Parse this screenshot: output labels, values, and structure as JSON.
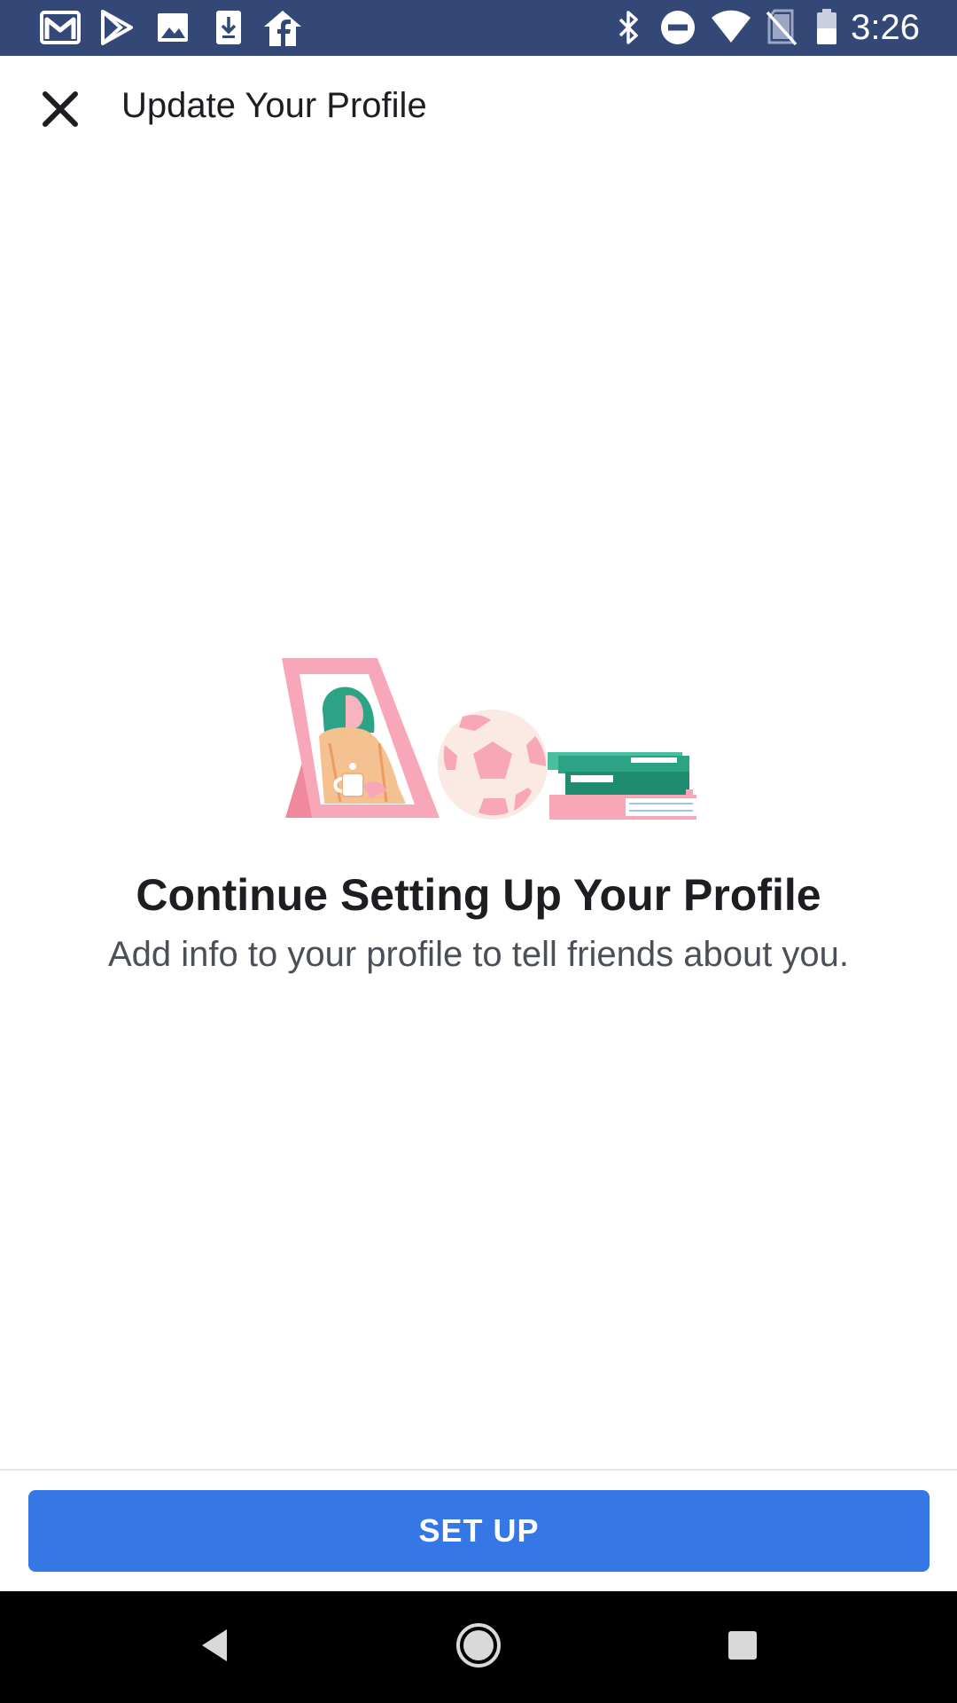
{
  "status_bar": {
    "time": "3:26",
    "background": "#344878",
    "left_icons": [
      "gmail-icon",
      "play-store-icon",
      "photos-icon",
      "download-icon",
      "facebook-home-icon"
    ],
    "right_icons": [
      "bluetooth-icon",
      "do-not-disturb-icon",
      "wifi-icon",
      "no-sim-icon",
      "battery-icon"
    ]
  },
  "app_bar": {
    "title": "Update Your Profile",
    "close_icon": "close-icon"
  },
  "content": {
    "illustration": "profile-setup-illustration",
    "headline": "Continue Setting Up Your Profile",
    "subtext": "Add info to your profile to tell friends about you."
  },
  "actions": {
    "setup_label": "SET UP",
    "accent": "#3578e5"
  },
  "nav_bar": {
    "icons": [
      "back-icon",
      "home-icon",
      "recents-icon"
    ]
  }
}
